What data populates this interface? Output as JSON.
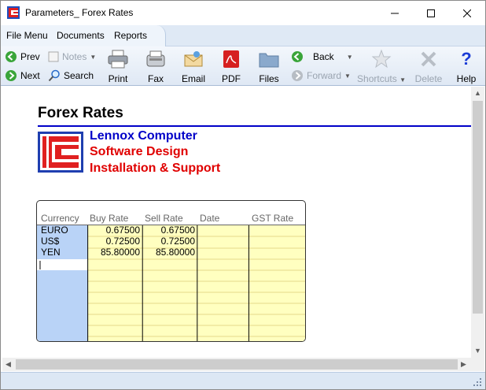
{
  "window": {
    "title": "Parameters_ Forex Rates"
  },
  "menu": {
    "items": [
      "File Menu",
      "Documents",
      "Reports"
    ]
  },
  "toolbar": {
    "prev": "Prev",
    "next": "Next",
    "notes": "Notes",
    "search": "Search",
    "print": "Print",
    "fax": "Fax",
    "email": "Email",
    "pdf": "PDF",
    "files": "Files",
    "back": "Back",
    "forward": "Forward",
    "shortcuts": "Shortcuts",
    "delete": "Delete",
    "help": "Help"
  },
  "document": {
    "title": "Forex Rates",
    "company_lines": [
      "Lennox Computer",
      "Software Design",
      "Installation & Support"
    ],
    "colors": {
      "blue": "#0000c8",
      "red": "#e00000",
      "grid_yellow": "#ffffc0",
      "grid_blue": "#b9d3f7"
    }
  },
  "grid": {
    "headers": [
      "Currency",
      "Buy Rate",
      "Sell Rate",
      "Date",
      "GST Rate"
    ],
    "rows": [
      [
        "EURO",
        "0.67500",
        "0.67500",
        "",
        ""
      ],
      [
        "US$",
        "0.72500",
        "0.72500",
        "",
        ""
      ],
      [
        "YEN",
        "85.80000",
        "85.80000",
        "",
        ""
      ]
    ]
  }
}
